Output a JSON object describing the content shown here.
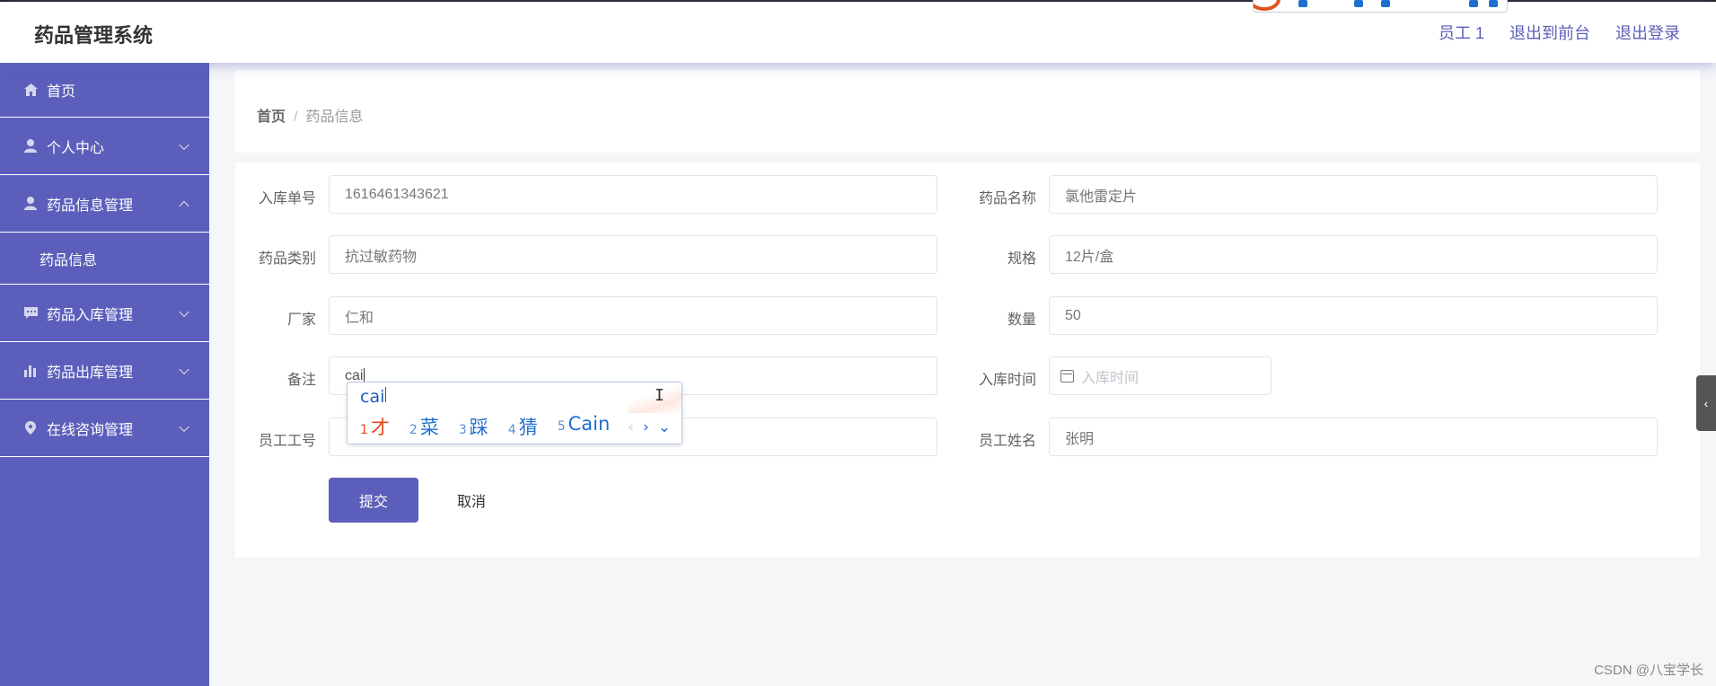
{
  "app": {
    "title": "药品管理系统"
  },
  "header": {
    "user": "员工 1",
    "to_front": "退出到前台",
    "logout": "退出登录"
  },
  "sidebar": {
    "items": [
      {
        "label": "首页",
        "icon": "home-icon"
      },
      {
        "label": "个人中心",
        "icon": "user-icon"
      },
      {
        "label": "药品信息管理",
        "icon": "user-icon",
        "expanded": true
      },
      {
        "label": "药品信息",
        "sub": true
      },
      {
        "label": "药品入库管理",
        "icon": "chat-icon"
      },
      {
        "label": "药品出库管理",
        "icon": "bar-chart-icon"
      },
      {
        "label": "在线咨询管理",
        "icon": "location-pin-icon"
      }
    ]
  },
  "breadcrumb": {
    "home": "首页",
    "separator": "/",
    "current": "药品信息"
  },
  "form": {
    "order_no": {
      "label": "入库单号",
      "value": "1616461343621"
    },
    "drug_name": {
      "label": "药品名称",
      "value": "氯他雷定片"
    },
    "category": {
      "label": "药品类别",
      "value": "抗过敏药物"
    },
    "spec": {
      "label": "规格",
      "value": "12片/盒"
    },
    "maker": {
      "label": "厂家",
      "value": "仁和"
    },
    "qty": {
      "label": "数量",
      "value": "50"
    },
    "remark": {
      "label": "备注",
      "value": "cai"
    },
    "date": {
      "label": "入库时间",
      "placeholder": "入库时间"
    },
    "emp_no": {
      "label": "员工工号",
      "value": ""
    },
    "emp_name": {
      "label": "员工姓名",
      "value": "张明"
    },
    "submit": "提交",
    "cancel": "取消"
  },
  "ime": {
    "pinyin": "cai",
    "candidates": [
      {
        "n": "1",
        "text": "才"
      },
      {
        "n": "2",
        "text": "菜"
      },
      {
        "n": "3",
        "text": "踩"
      },
      {
        "n": "4",
        "text": "猜"
      },
      {
        "n": "5",
        "text": "Cain"
      }
    ]
  },
  "watermark": "CSDN @八宝学长",
  "colors": {
    "accent": "#5b5fbb",
    "ime_selected": "#e24a1a",
    "ime_text": "#1f6fd1"
  }
}
